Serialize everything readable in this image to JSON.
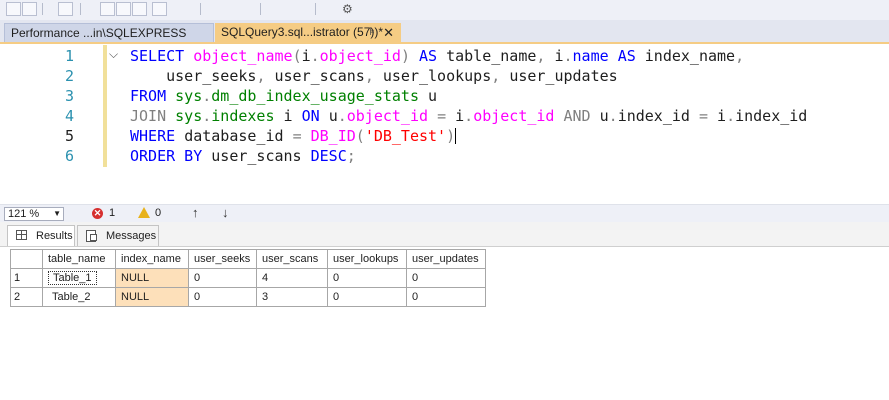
{
  "tabs": {
    "inactive_label": "Performance ...in\\SQLEXPRESS",
    "active_label": "SQLQuery3.sql...istrator (57))*",
    "pin_glyph": "⊧",
    "close_glyph": "✕"
  },
  "editor": {
    "line_numbers": [
      "1",
      "2",
      "3",
      "4",
      "5",
      "6"
    ],
    "lines": [
      [
        {
          "t": "SELECT ",
          "c": "kw"
        },
        {
          "t": "object_name",
          "c": "fn"
        },
        {
          "t": "(",
          "c": "gr"
        },
        {
          "t": "i",
          "c": "tx"
        },
        {
          "t": ".",
          "c": "gr"
        },
        {
          "t": "object_id",
          "c": "fn"
        },
        {
          "t": ") ",
          "c": "gr"
        },
        {
          "t": "AS ",
          "c": "kw"
        },
        {
          "t": "table_name",
          "c": "tx"
        },
        {
          "t": ", ",
          "c": "gr"
        },
        {
          "t": "i",
          "c": "tx"
        },
        {
          "t": ".",
          "c": "gr"
        },
        {
          "t": "name ",
          "c": "kw"
        },
        {
          "t": "AS ",
          "c": "kw"
        },
        {
          "t": "index_name",
          "c": "tx"
        },
        {
          "t": ",",
          "c": "gr"
        }
      ],
      [
        {
          "t": "    user_seeks",
          "c": "tx"
        },
        {
          "t": ", ",
          "c": "gr"
        },
        {
          "t": "user_scans",
          "c": "tx"
        },
        {
          "t": ", ",
          "c": "gr"
        },
        {
          "t": "user_lookups",
          "c": "tx"
        },
        {
          "t": ", ",
          "c": "gr"
        },
        {
          "t": "user_updates",
          "c": "tx"
        }
      ],
      [
        {
          "t": "FROM ",
          "c": "kw"
        },
        {
          "t": "sys",
          "c": "sy"
        },
        {
          "t": ".",
          "c": "gr"
        },
        {
          "t": "dm_db_index_usage_stats ",
          "c": "sy"
        },
        {
          "t": "u",
          "c": "tx"
        }
      ],
      [
        {
          "t": "JOIN ",
          "c": "gr"
        },
        {
          "t": "sys",
          "c": "sy"
        },
        {
          "t": ".",
          "c": "gr"
        },
        {
          "t": "indexes ",
          "c": "sy"
        },
        {
          "t": "i ",
          "c": "tx"
        },
        {
          "t": "ON ",
          "c": "kw"
        },
        {
          "t": "u",
          "c": "tx"
        },
        {
          "t": ".",
          "c": "gr"
        },
        {
          "t": "object_id ",
          "c": "fn"
        },
        {
          "t": "= ",
          "c": "gr"
        },
        {
          "t": "i",
          "c": "tx"
        },
        {
          "t": ".",
          "c": "gr"
        },
        {
          "t": "object_id ",
          "c": "fn"
        },
        {
          "t": "AND ",
          "c": "gr"
        },
        {
          "t": "u",
          "c": "tx"
        },
        {
          "t": ".",
          "c": "gr"
        },
        {
          "t": "index_id ",
          "c": "tx"
        },
        {
          "t": "= ",
          "c": "gr"
        },
        {
          "t": "i",
          "c": "tx"
        },
        {
          "t": ".",
          "c": "gr"
        },
        {
          "t": "index_id",
          "c": "tx"
        }
      ],
      [
        {
          "t": "WHERE ",
          "c": "kw"
        },
        {
          "t": "database_id ",
          "c": "tx"
        },
        {
          "t": "= ",
          "c": "gr"
        },
        {
          "t": "DB_ID",
          "c": "fn"
        },
        {
          "t": "(",
          "c": "gr"
        },
        {
          "t": "'DB_Test'",
          "c": "st"
        },
        {
          "t": ")",
          "c": "gr"
        }
      ],
      [
        {
          "t": "ORDER BY ",
          "c": "kw"
        },
        {
          "t": "user_scans ",
          "c": "tx"
        },
        {
          "t": "DESC",
          "c": "kw"
        },
        {
          "t": ";",
          "c": "gr"
        }
      ]
    ]
  },
  "status": {
    "zoom": "121 %",
    "error_count": "1",
    "warning_count": "0",
    "up_glyph": "↑",
    "down_glyph": "↓"
  },
  "results": {
    "tab_results": "Results",
    "tab_messages": "Messages",
    "columns": [
      "table_name",
      "index_name",
      "user_seeks",
      "user_scans",
      "user_lookups",
      "user_updates"
    ],
    "rows": [
      {
        "num": "1",
        "table_name": "Table_1",
        "index_name": "NULL",
        "user_seeks": "0",
        "user_scans": "4",
        "user_lookups": "0",
        "user_updates": "0"
      },
      {
        "num": "2",
        "table_name": "Table_2",
        "index_name": "NULL",
        "user_seeks": "0",
        "user_scans": "3",
        "user_lookups": "0",
        "user_updates": "0"
      }
    ]
  },
  "colors": {
    "active_tab": "#f5cc84",
    "keyword": "#0000ff",
    "function": "#ff00ff",
    "system_object": "#008000",
    "string": "#ff0000",
    "null_cell": "#fde0ba"
  }
}
